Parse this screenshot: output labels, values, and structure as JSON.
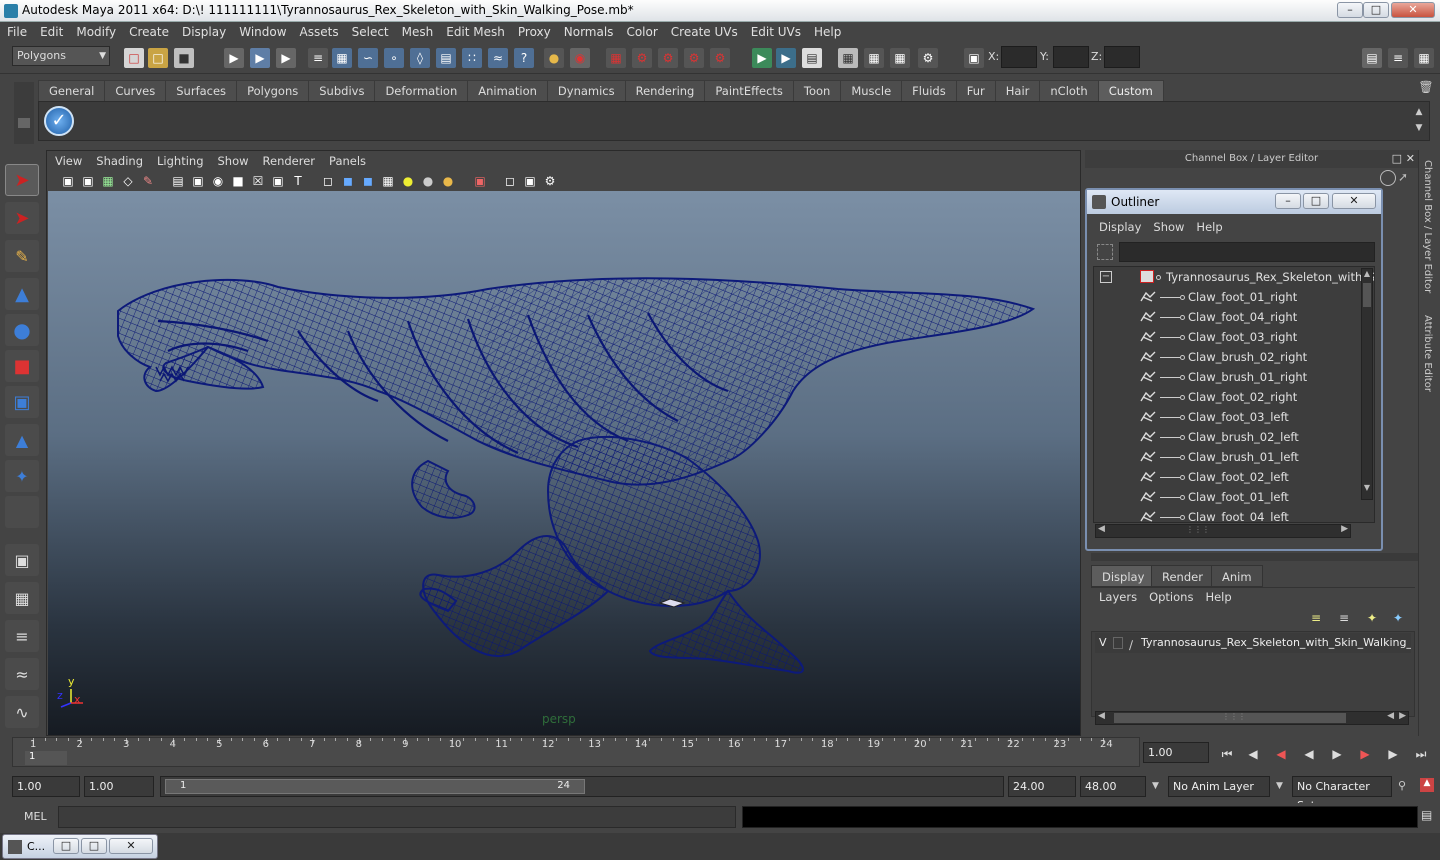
{
  "window": {
    "title": "Autodesk Maya 2011 x64: D:\\! 111111111\\Tyrannosaurus_Rex_Skeleton_with_Skin_Walking_Pose.mb*",
    "minimize": "–",
    "maximize": "□",
    "close": "✕"
  },
  "menubar": [
    "File",
    "Edit",
    "Modify",
    "Create",
    "Display",
    "Window",
    "Assets",
    "Select",
    "Mesh",
    "Edit Mesh",
    "Proxy",
    "Normals",
    "Color",
    "Create UVs",
    "Edit UVs",
    "Help"
  ],
  "statusline": {
    "menuset": "Polygons",
    "x_label": "X:",
    "y_label": "Y:",
    "z_label": "Z:"
  },
  "shelf": {
    "tabs": [
      "General",
      "Curves",
      "Surfaces",
      "Polygons",
      "Subdivs",
      "Deformation",
      "Animation",
      "Dynamics",
      "Rendering",
      "PaintEffects",
      "Toon",
      "Muscle",
      "Fluids",
      "Fur",
      "Hair",
      "nCloth",
      "Custom"
    ],
    "active_tab": "Custom"
  },
  "viewport": {
    "menus": [
      "View",
      "Shading",
      "Lighting",
      "Show",
      "Renderer",
      "Panels"
    ],
    "camera_label": "persp",
    "axis_y": "y",
    "axis_x": "x",
    "axis_z": "z"
  },
  "channel_box": {
    "header": "Channel Box / Layer Editor",
    "side_tab_1": "Channel Box / Layer Editor",
    "side_tab_2": "Attribute Editor"
  },
  "outliner": {
    "title": "Outliner",
    "menus": [
      "Display",
      "Show",
      "Help"
    ],
    "root": "Tyrannosaurus_Rex_Skeleton_with_Skin",
    "collapse_symbol": "−",
    "items": [
      "Claw_foot_01_right",
      "Claw_foot_04_right",
      "Claw_foot_03_right",
      "Claw_brush_02_right",
      "Claw_brush_01_right",
      "Claw_foot_02_right",
      "Claw_foot_03_left",
      "Claw_brush_02_left",
      "Claw_brush_01_left",
      "Claw_foot_02_left",
      "Claw_foot_01_left",
      "Claw_foot_04_left"
    ]
  },
  "layer_editor": {
    "tabs": [
      "Display",
      "Render",
      "Anim"
    ],
    "active_tab": "Display",
    "menus": [
      "Layers",
      "Options",
      "Help"
    ],
    "layer_visible": "V",
    "layer_name": "Tyrannosaurus_Rex_Skeleton_with_Skin_Walking_Pose_"
  },
  "time_slider": {
    "ticks": [
      "1",
      "2",
      "3",
      "4",
      "5",
      "6",
      "7",
      "8",
      "9",
      "10",
      "11",
      "12",
      "13",
      "14",
      "15",
      "16",
      "17",
      "18",
      "19",
      "20",
      "21",
      "22",
      "23",
      "24"
    ],
    "current_frame_marker": "1",
    "current_time": "1.00"
  },
  "range_slider": {
    "start_time": "1.00",
    "playback_start": "1.00",
    "range_start_label": "1",
    "range_end_label": "24",
    "playback_end": "24.00",
    "end_time": "48.00",
    "anim_layer": "No Anim Layer",
    "character_set": "No Character Set"
  },
  "command_line": {
    "label": "MEL"
  },
  "taskbar": {
    "window_label": "C..."
  },
  "colors": {
    "wireframe": "#0d1a7a",
    "selection_accent": "#7a8fb0"
  }
}
